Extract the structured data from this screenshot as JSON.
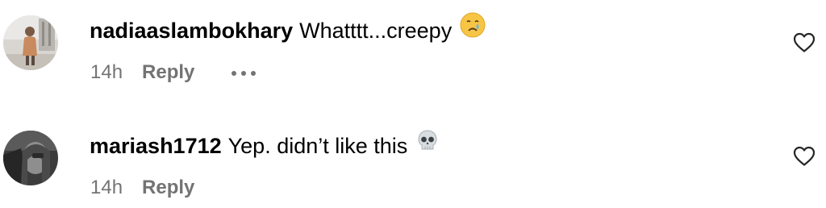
{
  "comments": [
    {
      "username": "nadiaaslambokhary",
      "text": "Whatttt...creepy",
      "emoji": "crying-face-emoji",
      "time": "14h",
      "reply_label": "Reply",
      "has_more_menu": true,
      "liked": false
    },
    {
      "username": "mariash1712",
      "text": "Yep. didn’t like this",
      "emoji": "skull-emoji",
      "time": "14h",
      "reply_label": "Reply",
      "has_more_menu": false,
      "liked": false
    }
  ],
  "colors": {
    "text_primary": "#000000",
    "text_secondary": "#737373",
    "background": "#ffffff"
  }
}
